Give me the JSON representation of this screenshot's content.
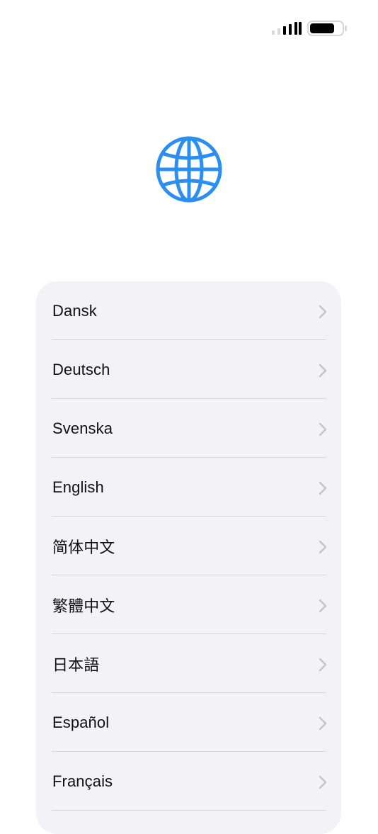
{
  "status_bar": {
    "signal_icon": "cellular-signal-icon",
    "battery_icon": "battery-icon",
    "signal_bars_active": 3,
    "battery_level": 0.9
  },
  "hero": {
    "icon": "globe-icon",
    "accent_color": "#2a8ff0"
  },
  "languages": [
    {
      "label": "Dansk"
    },
    {
      "label": "Deutsch"
    },
    {
      "label": "Svenska"
    },
    {
      "label": "English"
    },
    {
      "label": "简体中文"
    },
    {
      "label": "繁體中文"
    },
    {
      "label": "日本語"
    },
    {
      "label": "Español"
    },
    {
      "label": "Français"
    }
  ],
  "row_icon": "chevron-right-icon",
  "colors": {
    "card_background": "#f2f2f7",
    "separator": "#d5d5da",
    "chevron": "#c4c4c9"
  }
}
